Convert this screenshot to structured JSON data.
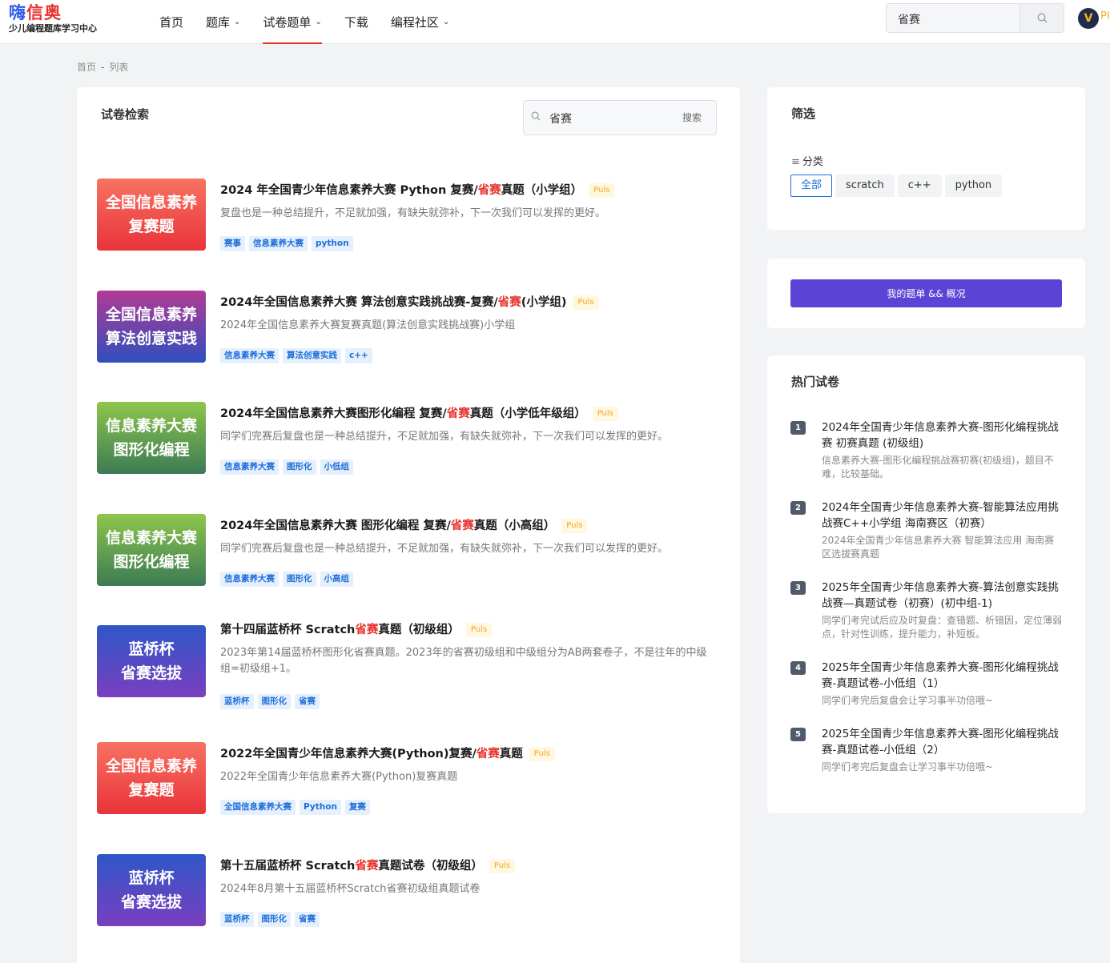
{
  "header": {
    "logo": {
      "part_blue": "嗨",
      "part_red": "信奥",
      "subtitle": "少儿编程题库学习中心"
    },
    "nav": [
      {
        "label": "首页",
        "dropdown": false
      },
      {
        "label": "题库",
        "dropdown": true
      },
      {
        "label": "试卷题单",
        "dropdown": true,
        "active": true
      },
      {
        "label": "下载",
        "dropdown": false
      },
      {
        "label": "编程社区",
        "dropdown": true
      }
    ],
    "search_value": "省赛",
    "user_name": "PI"
  },
  "breadcrumb": {
    "home": "首页",
    "sep": "-",
    "current": "列表"
  },
  "main": {
    "title": "试卷检索",
    "search_value": "省赛",
    "search_button": "搜索",
    "items": [
      {
        "thumb": {
          "line1": "全国信息素养",
          "line2": "复赛题",
          "color": "red"
        },
        "title_before": "2024 年全国青少年信息素养大赛 Python 复赛/",
        "title_highlight": "省赛",
        "title_after": "真题（小学组）",
        "badge": "Puls",
        "desc": "复盘也是一种总结提升，不足就加强，有缺失就弥补，下一次我们可以发挥的更好。",
        "tags": [
          "赛事",
          "信息素养大赛",
          "python"
        ]
      },
      {
        "thumb": {
          "line1": "全国信息素养",
          "line2": "算法创意实践",
          "color": "purple"
        },
        "title_before": "2024年全国信息素养大赛 算法创意实践挑战赛-复赛/",
        "title_highlight": "省赛",
        "title_after": "(小学组)",
        "badge": "Puls",
        "desc": "2024年全国信息素养大赛复赛真题(算法创意实践挑战赛)小学组",
        "tags": [
          "信息素养大赛",
          "算法创意实践",
          "c++"
        ]
      },
      {
        "thumb": {
          "line1": "信息素养大赛",
          "line2": "图形化编程",
          "color": "green"
        },
        "title_before": "2024年全国信息素养大赛图形化编程 复赛/",
        "title_highlight": "省赛",
        "title_after": "真题（小学低年级组）",
        "badge": "Puls",
        "desc": "同学们完赛后复盘也是一种总结提升，不足就加强，有缺失就弥补，下一次我们可以发挥的更好。",
        "tags": [
          "信息素养大赛",
          "图形化",
          "小低组"
        ]
      },
      {
        "thumb": {
          "line1": "信息素养大赛",
          "line2": "图形化编程",
          "color": "green"
        },
        "title_before": "2024年全国信息素养大赛 图形化编程 复赛/",
        "title_highlight": "省赛",
        "title_after": "真题（小高组）",
        "badge": "Puls",
        "desc": "同学们完赛后复盘也是一种总结提升，不足就加强，有缺失就弥补，下一次我们可以发挥的更好。",
        "tags": [
          "信息素养大赛",
          "图形化",
          "小高组"
        ]
      },
      {
        "thumb": {
          "line1": "蓝桥杯",
          "line2": "省赛选拔",
          "color": "blue"
        },
        "title_before": "第十四届蓝桥杯 Scratch",
        "title_highlight": "省赛",
        "title_after": "真题（初级组）",
        "badge": "Puls",
        "desc": "2023年第14届蓝桥杯图形化省赛真题。2023年的省赛初级组和中级组分为AB两套卷子，不是往年的中级组=初级组+1。",
        "tags": [
          "蓝桥杯",
          "图形化",
          "省赛"
        ]
      },
      {
        "thumb": {
          "line1": "全国信息素养",
          "line2": "复赛题",
          "color": "red"
        },
        "title_before": "2022年全国青少年信息素养大赛(Python)复赛/",
        "title_highlight": "省赛",
        "title_after": "真题",
        "badge": "Puls",
        "desc": "2022年全国青少年信息素养大赛(Python)复赛真题",
        "tags": [
          "全国信息素养大赛",
          "Python",
          "复赛"
        ]
      },
      {
        "thumb": {
          "line1": "蓝桥杯",
          "line2": "省赛选拔",
          "color": "blue"
        },
        "title_before": "第十五届蓝桥杯 Scratch",
        "title_highlight": "省赛",
        "title_after": "真题试卷（初级组）",
        "badge": "Puls",
        "desc": "2024年8月第十五届蓝桥杯Scratch省赛初级组真题试卷",
        "tags": [
          "蓝桥杯",
          "图形化",
          "省赛"
        ]
      }
    ]
  },
  "filter": {
    "title": "筛选",
    "category_label": "分类",
    "options": [
      "全部",
      "scratch",
      "c++",
      "python"
    ],
    "selected": "全部"
  },
  "my_list_button": "我的题单 && 概况",
  "hot": {
    "title": "热门试卷",
    "items": [
      {
        "num": "1",
        "title": "2024年全国青少年信息素养大赛-图形化编程挑战赛 初赛真题 (初级组)",
        "desc": "信息素养大赛-图形化编程挑战赛初赛(初级组)，题目不难，比较基础。"
      },
      {
        "num": "2",
        "title": "2024年全国青少年信息素养大赛-智能算法应用挑战赛C++小学组 海南赛区（初赛）",
        "desc": "2024年全国青少年信息素养大赛 智能算法应用 海南赛区选拔赛真题"
      },
      {
        "num": "3",
        "title": "2025年全国青少年信息素养大赛-算法创意实践挑战赛—真题试卷（初赛）(初中组-1)",
        "desc": "同学们考完试后应及时复盘：查错题、析错因，定位薄弱点，针对性训练，提升能力，补短板。"
      },
      {
        "num": "4",
        "title": "2025年全国青少年信息素养大赛-图形化编程挑战赛-真题试卷-小低组（1）",
        "desc": "同学们考完后复盘会让学习事半功倍哦~"
      },
      {
        "num": "5",
        "title": "2025年全国青少年信息素养大赛-图形化编程挑战赛-真题试卷-小低组（2）",
        "desc": "同学们考完后复盘会让学习事半功倍哦~"
      }
    ]
  },
  "colors": {
    "accent_red": "#e8332d",
    "brand_blue": "#2f5bea",
    "button_purple": "#5b43d6",
    "tag_blue": "#1e6fd9"
  }
}
